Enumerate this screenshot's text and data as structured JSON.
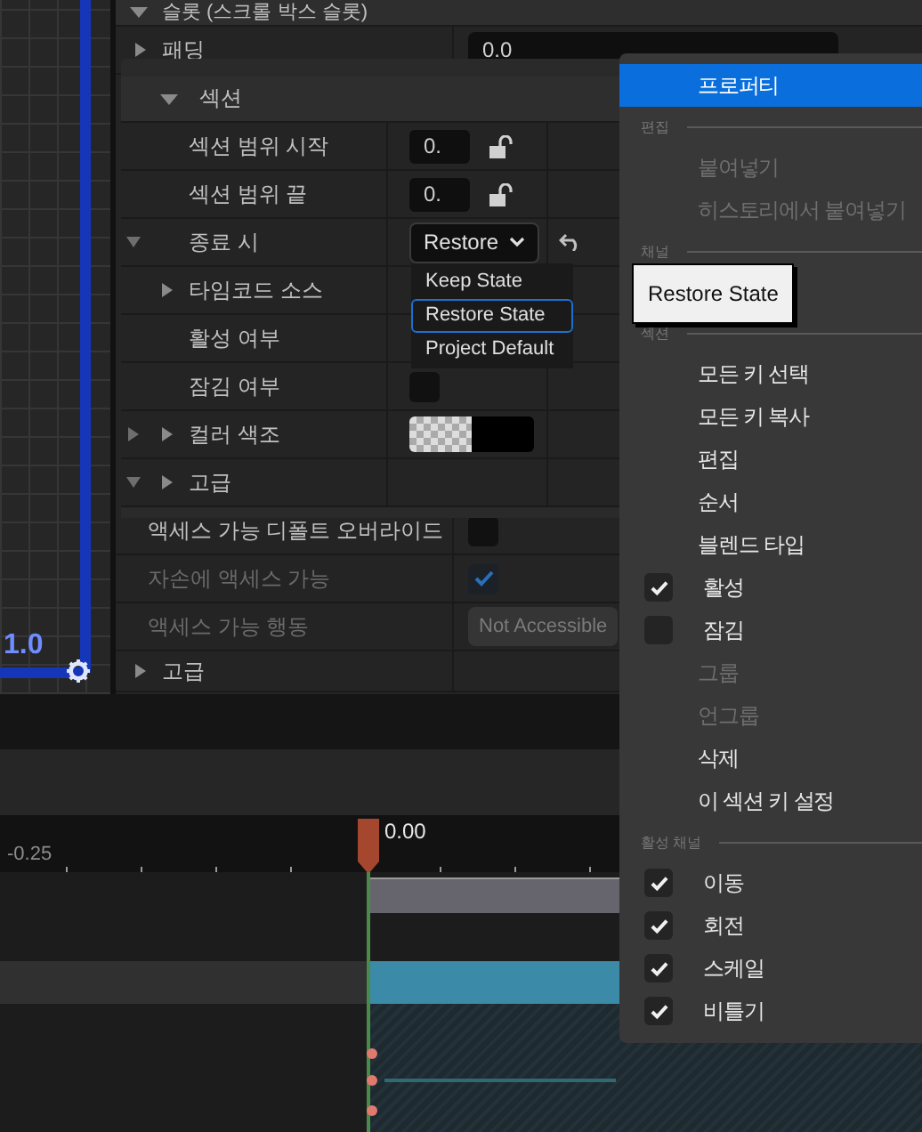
{
  "viewport": {
    "scale_label": "1.0"
  },
  "details": {
    "header": "슬롯 (스크롤 박스 슬롯)",
    "rows": [
      {
        "kind": "text",
        "label": "패딩",
        "value": "0.0",
        "expandable": true
      },
      {
        "kind": "check",
        "label": "액세스 가능 디폴트 오버라이드",
        "checked": false,
        "disabled": false
      },
      {
        "kind": "check",
        "label": "자손에 액세스 가능",
        "checked": true,
        "disabled": true
      },
      {
        "kind": "select",
        "label": "액세스 가능 행동",
        "value": "Not Accessible",
        "disabled": true
      },
      {
        "kind": "group",
        "label": "고급",
        "expandable": true
      }
    ]
  },
  "section_popup": {
    "title": "섹션",
    "rows": [
      {
        "kind": "number",
        "label": "섹션 범위 시작",
        "value": "0.",
        "locked": false
      },
      {
        "kind": "number",
        "label": "섹션 범위 끝",
        "value": "0.",
        "locked": false
      },
      {
        "kind": "select",
        "label": "종료 시",
        "value": "Restore",
        "outer_arrow": true,
        "outer_expanded": true
      },
      {
        "kind": "group",
        "label": "타임코드 소스"
      },
      {
        "kind": "label",
        "label": "활성 여부"
      },
      {
        "kind": "check",
        "label": "잠김 여부",
        "checked": false
      },
      {
        "kind": "color",
        "label": "컬러 색조",
        "outer_arrow": true,
        "outer_expanded": false
      },
      {
        "kind": "group",
        "label": "고급",
        "outer_arrow": true,
        "outer_expanded": true
      }
    ]
  },
  "dropdown": {
    "options": [
      {
        "label": "Keep State",
        "selected": false
      },
      {
        "label": "Restore State",
        "selected": true
      },
      {
        "label": "Project Default",
        "selected": false
      }
    ]
  },
  "context_menu": {
    "items": [
      {
        "kind": "item",
        "label": "프로퍼티",
        "highlighted": true,
        "disabled": false
      },
      {
        "kind": "header",
        "label": "편집"
      },
      {
        "kind": "item",
        "label": "붙여넣기",
        "highlighted": false,
        "disabled": true
      },
      {
        "kind": "item",
        "label": "히스토리에서 붙여넣기",
        "highlighted": false,
        "disabled": true
      },
      {
        "kind": "header",
        "label": "채널"
      },
      {
        "kind": "gap"
      },
      {
        "kind": "header",
        "label": "섹션"
      },
      {
        "kind": "item",
        "label": "모든 키 선택",
        "highlighted": false,
        "disabled": false
      },
      {
        "kind": "item",
        "label": "모든 키 복사",
        "highlighted": false,
        "disabled": false
      },
      {
        "kind": "item",
        "label": "편집",
        "highlighted": false,
        "disabled": false
      },
      {
        "kind": "item",
        "label": "순서",
        "highlighted": false,
        "disabled": false
      },
      {
        "kind": "item",
        "label": "블렌드 타입",
        "highlighted": false,
        "disabled": false
      },
      {
        "kind": "check",
        "label": "활성",
        "checked": true
      },
      {
        "kind": "check",
        "label": "잠김",
        "checked": false
      },
      {
        "kind": "item",
        "label": "그룹",
        "highlighted": false,
        "disabled": true
      },
      {
        "kind": "item",
        "label": "언그룹",
        "highlighted": false,
        "disabled": true
      },
      {
        "kind": "item",
        "label": "삭제",
        "highlighted": false,
        "disabled": false
      },
      {
        "kind": "item",
        "label": "이 섹션 키 설정",
        "highlighted": false,
        "disabled": false
      },
      {
        "kind": "header",
        "label": "활성 채널"
      },
      {
        "kind": "check",
        "label": "이동",
        "checked": true
      },
      {
        "kind": "check",
        "label": "회전",
        "checked": true
      },
      {
        "kind": "check",
        "label": "스케일",
        "checked": true
      },
      {
        "kind": "check",
        "label": "비틀기",
        "checked": true
      }
    ]
  },
  "tooltip": {
    "text": "Restore State"
  },
  "timeline": {
    "ruler_label": "-0.25",
    "playhead": "0.00"
  }
}
